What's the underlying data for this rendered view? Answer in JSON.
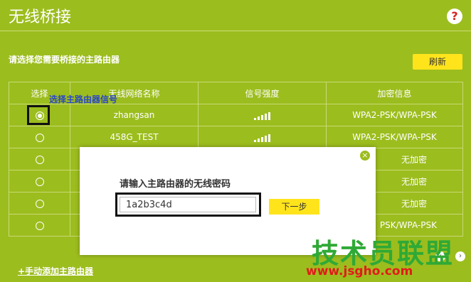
{
  "header": {
    "title": "无线桥接",
    "help_label": "?"
  },
  "instruction": "请选择您需要桥接的主路由器",
  "refresh_label": "刷新",
  "table": {
    "columns": [
      "选择",
      "无线网络名称",
      "信号强度",
      "加密信息"
    ],
    "rows": [
      {
        "ssid": "zhangsan",
        "security": "WPA2-PSK/WPA-PSK",
        "selected": true
      },
      {
        "ssid": "458G_TEST",
        "security": "WPA2-PSK/WPA-PSK",
        "selected": false
      },
      {
        "ssid": "",
        "security": "无加密",
        "selected": false
      },
      {
        "ssid": "",
        "security": "无加密",
        "selected": false
      },
      {
        "ssid": "",
        "security": "无加密",
        "selected": false
      },
      {
        "ssid": "",
        "security": "PSK/WPA-PSK",
        "selected": false
      }
    ]
  },
  "annotation": "选择主路由器信号",
  "dialog": {
    "label": "请输入主路由器的无线密码",
    "password_value": "1a2b3c4d",
    "next_label": "下一步",
    "close_label": "×"
  },
  "add_router_label": "+手动添加主路由器",
  "watermark": {
    "big": "技术员联盟",
    "url": "www.jsgho.com"
  },
  "colors": {
    "background": "#9cbd1e",
    "button": "#ffe41c",
    "annotation": "#2a46c8",
    "highlight": "#111111"
  }
}
